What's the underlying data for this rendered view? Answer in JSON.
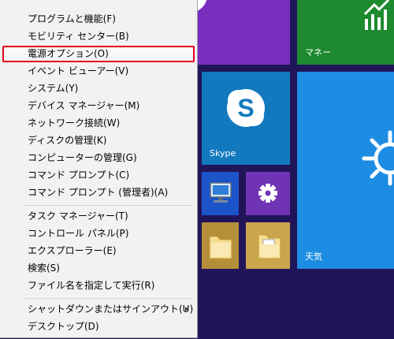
{
  "menu": {
    "items": [
      {
        "label": "プログラムと機能(F)"
      },
      {
        "label": "モビリティ センター(B)"
      },
      {
        "label": "電源オプション(O)"
      },
      {
        "label": "イベント ビューアー(V)"
      },
      {
        "label": "システム(Y)"
      },
      {
        "label": "デバイス マネージャー(M)"
      },
      {
        "label": "ネットワーク接続(W)"
      },
      {
        "label": "ディスクの管理(K)"
      },
      {
        "label": "コンピューターの管理(G)"
      },
      {
        "label": "コマンド プロンプト(C)"
      },
      {
        "label": "コマンド プロンプト (管理者)(A)"
      },
      {
        "label": "タスク マネージャー(T)"
      },
      {
        "label": "コントロール パネル(P)"
      },
      {
        "label": "エクスプローラー(E)"
      },
      {
        "label": "検索(S)"
      },
      {
        "label": "ファイル名を指定して実行(R)"
      },
      {
        "label": "シャットダウンまたはサインアウト(U)"
      },
      {
        "label": "デスクトップ(D)"
      }
    ]
  },
  "tiles": {
    "money": {
      "label": "マネー",
      "color": "#1e8a2f",
      "icon": "chart-icon"
    },
    "skype": {
      "label": "Skype",
      "color": "#1279bf",
      "icon": "skype-icon"
    },
    "weather": {
      "label": "天気",
      "color": "#1d8ce3",
      "icon": "sun-icon"
    },
    "computer": {
      "icon": "computer-icon",
      "color": "#1c55c9"
    },
    "settings": {
      "icon": "gear-icon",
      "color": "#6f33b4"
    },
    "folder1": {
      "icon": "folder-icon"
    },
    "folder2": {
      "icon": "folder-icon"
    }
  },
  "colors": {
    "start_background": "#21155a",
    "highlight_border": "#e5001c"
  }
}
